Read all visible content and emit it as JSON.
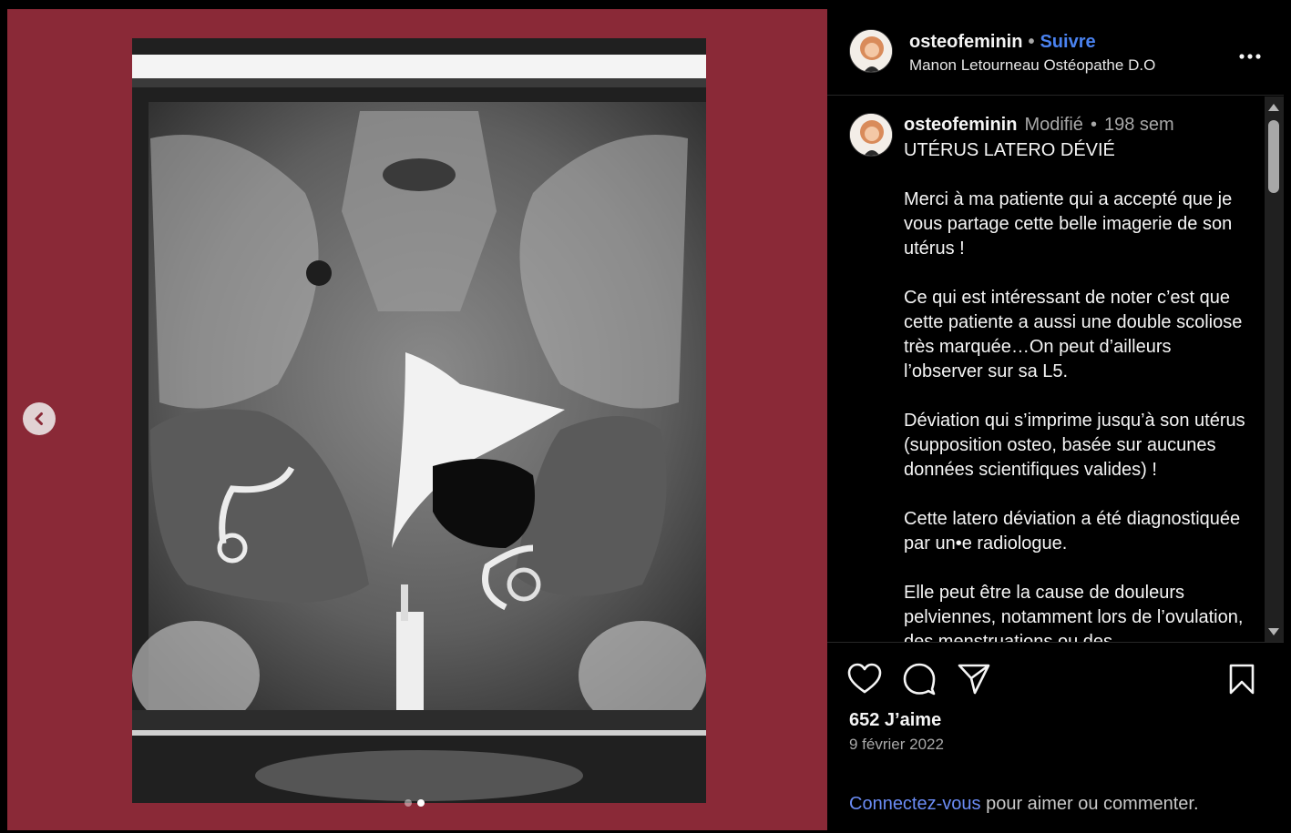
{
  "post_header": {
    "username": "osteofeminin",
    "separator": "•",
    "follow_label": "Suivre",
    "subtitle": "Manon Letourneau Ostéopathe D.O",
    "more_icon": "more-horizontal-icon"
  },
  "caption": {
    "username": "osteofeminin",
    "edited_label": "Modifié",
    "separator": "•",
    "age": "198 sem",
    "text": "UTÉRUS LATERO DÉVIÉ\n\nMerci à ma patiente qui a accepté que je vous partage cette belle imagerie de son utérus !\n\nCe qui est intéressant de noter c’est que cette patiente a aussi une double scoliose très marquée…On peut d’ailleurs l’observer sur sa L5.\n\nDéviation qui s’imprime jusqu’à son utérus (supposition osteo, basée sur aucunes données scientifiques valides) !\n\nCette latero déviation a été diagnostiquée par un•e radiologue.\n\nElle peut être la cause de douleurs pelviennes, notamment lors de l’ovulation, des menstruations ou des"
  },
  "actions": {
    "like_icon": "heart-icon",
    "comment_icon": "comment-icon",
    "share_icon": "send-icon",
    "save_icon": "bookmark-icon"
  },
  "likes": "652 J’aime",
  "date": "9 février 2022",
  "login_prompt": {
    "link": "Connectez-vous",
    "rest": " pour aimer ou commenter."
  },
  "carousel": {
    "prev_icon": "chevron-left-icon",
    "count": 2,
    "active_index": 1
  },
  "colors": {
    "media_background": "#8a2937",
    "follow": "#4a82f0",
    "login_link": "#6b8cf5"
  }
}
